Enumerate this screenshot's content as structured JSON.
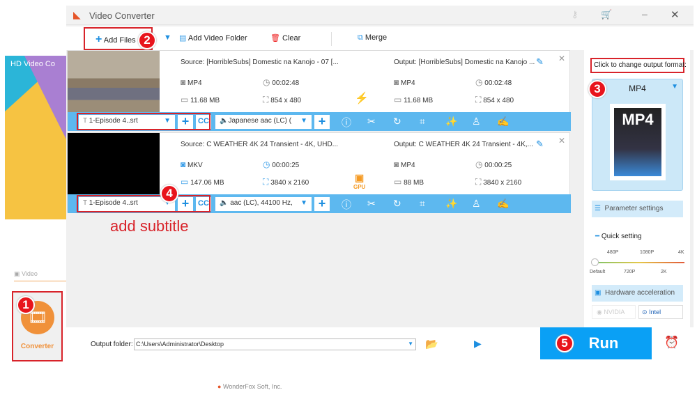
{
  "splash": {
    "title": "HD Video Co"
  },
  "sidebar": {
    "video_label": "Video",
    "converter_label": "Converter"
  },
  "window": {
    "title": "Video Converter",
    "icons": [
      "key-icon",
      "cart-icon",
      "minimize-icon",
      "close-icon"
    ]
  },
  "toolbar": {
    "add_files": "Add Files",
    "add_video_folder": "Add Video Folder",
    "clear": "Clear",
    "merge": "Merge"
  },
  "files": [
    {
      "source": "Source: [HorribleSubs] Domestic na Kanojo - 07 [...",
      "src_format": "MP4",
      "src_duration": "00:02:48",
      "src_size": "11.68 MB",
      "src_resolution": "854 x 480",
      "output": "Output: [HorribleSubs] Domestic na Kanojo ...",
      "out_format": "MP4",
      "out_duration": "00:02:48",
      "out_size": "11.68 MB",
      "out_resolution": "854 x 480",
      "subtitle": "1-Episode 4..srt",
      "audio": "Japanese aac (LC) (",
      "accel": "lightning-icon"
    },
    {
      "source": "Source: C  WEATHER  4K 24  Transient - 4K, UHD...",
      "src_format": "MKV",
      "src_duration": "00:00:25",
      "src_size": "147.06 MB",
      "src_resolution": "3840 x 2160",
      "output": "Output: C  WEATHER  4K 24  Transient - 4K,...",
      "out_format": "MP4",
      "out_duration": "00:00:25",
      "out_size": "88 MB",
      "out_resolution": "3840 x 2160",
      "subtitle": "1-Episode 4..srt",
      "audio": "aac (LC), 44100 Hz,",
      "accel": "GPU"
    }
  ],
  "annotations": {
    "add_subtitle": "add subtitle",
    "steps": [
      "1",
      "2",
      "3",
      "4",
      "5"
    ]
  },
  "right_panel": {
    "hint": "Click to change output format:",
    "format": "MP4",
    "format_icon_text": "MP4",
    "parameter_settings": "Parameter settings",
    "quick_setting": "Quick setting",
    "quality_top": [
      "480P",
      "1080P",
      "4K"
    ],
    "quality_bottom": [
      "Default",
      "720P",
      "2K"
    ],
    "quality_selected": "Default",
    "hardware_acceleration": "Hardware acceleration",
    "nvidia": "NVIDIA",
    "intel": "Intel"
  },
  "bottom": {
    "output_folder_label": "Output folder:",
    "output_folder_value": "C:\\Users\\Administrator\\Desktop",
    "run": "Run",
    "footer": "WonderFox Soft, Inc."
  },
  "colors": {
    "accent": "#0aa0f5",
    "bar": "#5db8ef",
    "annotation": "#d8232a",
    "converter": "#f0913a"
  }
}
